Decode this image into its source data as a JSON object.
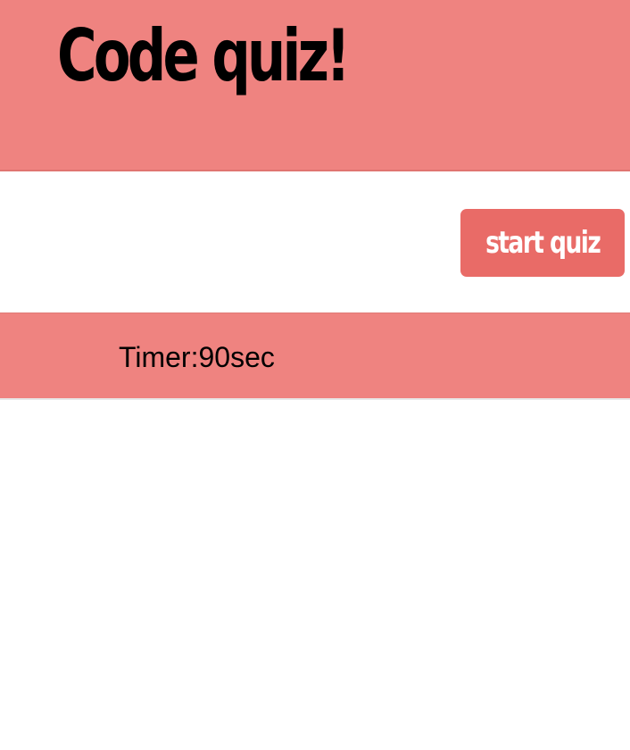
{
  "header": {
    "title": "Code quiz!",
    "background_color": "#ef8380"
  },
  "controls": {
    "start_label": "start quiz",
    "start_color": "#e96b67"
  },
  "timer": {
    "text": "Timer:90sec"
  }
}
